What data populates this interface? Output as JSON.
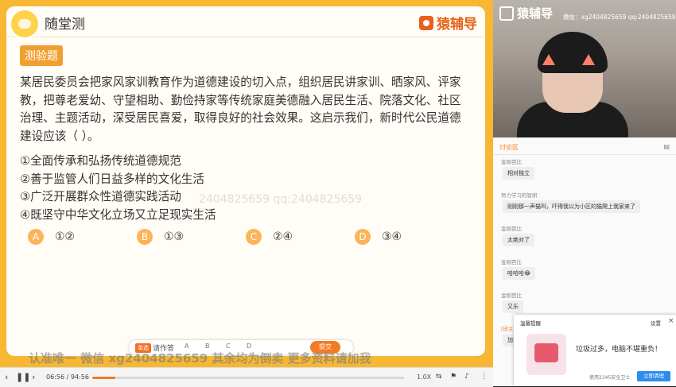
{
  "header": {
    "title": "随堂测",
    "brand": "猿辅导"
  },
  "tag": "测验题",
  "question": {
    "stem": "某居民委员会把家风家训教育作为道德建设的切入点，组织居民讲家训、晒家风、评家教，把尊老爱幼、守望相助、勤俭持家等传统家庭美德融入居民生活、院落文化、社区治理、主题活动，深受居民喜爱，取得良好的社会效果。这启示我们，新时代公民道德建设应该（ ）。",
    "items": [
      "①全面传承和弘扬传统道德规范",
      "②善于监管人们日益多样的文化生活",
      "③广泛开展群众性道德实践活动",
      "④既坚守中华文化立场又立足现实生活"
    ],
    "answers": [
      {
        "letter": "A",
        "text": "①②"
      },
      {
        "letter": "B",
        "text": "①③"
      },
      {
        "letter": "C",
        "text": "②④"
      },
      {
        "letter": "D",
        "text": "③④"
      }
    ]
  },
  "watermark": "2404825659   qq:2404825659",
  "answer_bar": {
    "badge": "单选",
    "label": "请作答",
    "choices": [
      "A",
      "B",
      "C",
      "D"
    ],
    "submit": "提交"
  },
  "bottom_watermark": "认准唯一 微信 xg2404825659  其余均为倒卖  更多资料请加我",
  "player": {
    "current": "06:56",
    "total": "94:56",
    "separator": "/",
    "speed": "1.0X",
    "progress": 0.073
  },
  "video": {
    "logo": "猿辅导",
    "contact": "微信：xg2404825659  qq:2404825659"
  },
  "chat": {
    "title": "讨论区",
    "messages": [
      {
        "user": "金刚芭比",
        "text": "相对独立"
      },
      {
        "user": "努力学习的智妍",
        "text": "刚刚那一声猫叫，吓得我以为小区的猫爬上我家来了"
      },
      {
        "user": "金刚芭比",
        "text": "太绝对了"
      },
      {
        "user": "金刚芭比",
        "text": "哈哈哈😂"
      },
      {
        "user": "金刚芭比",
        "text": "又乐"
      },
      {
        "user": "[班主任]",
        "text": "加油"
      }
    ]
  },
  "popup": {
    "title": "温馨提醒",
    "settings": "设置",
    "message": "垃圾过多，电脑不堪重负！",
    "from": "使用2345安全卫士",
    "button": "立即清理"
  }
}
